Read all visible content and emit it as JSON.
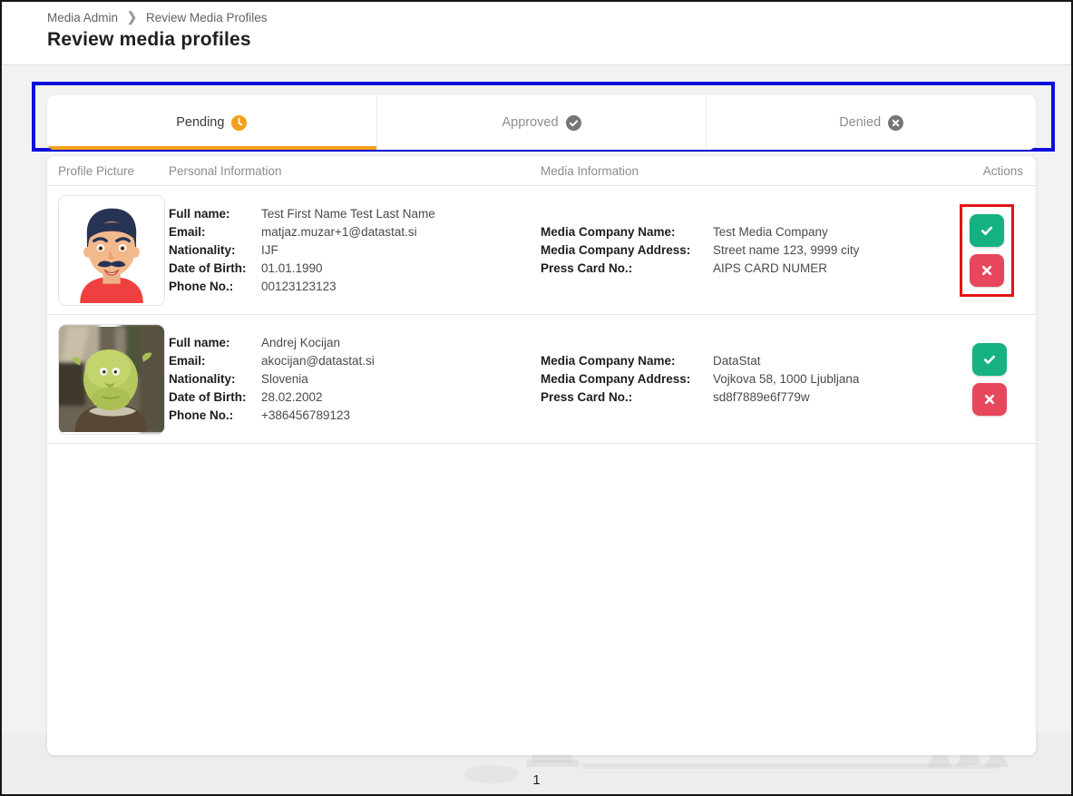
{
  "header": {
    "breadcrumb": [
      "Media Admin",
      "Review Media Profiles"
    ],
    "breadcrumb_separator": "❯",
    "title": "Review media profiles"
  },
  "tabs": [
    {
      "label": "Pending",
      "icon": "clock-icon",
      "active": true
    },
    {
      "label": "Approved",
      "icon": "check-circle-icon",
      "active": false
    },
    {
      "label": "Denied",
      "icon": "x-circle-icon",
      "active": false
    }
  ],
  "table": {
    "columns": [
      "Profile Picture",
      "Personal Information",
      "Media Information",
      "Actions"
    ],
    "personal_labels": [
      "Full name:",
      "Email:",
      "Nationality:",
      "Date of Birth:",
      "Phone No.:"
    ],
    "media_labels": [
      "Media Company Name:",
      "Media Company Address:",
      "Press Card No.:"
    ],
    "rows": [
      {
        "avatar": "cartoon-man-avatar",
        "personal": {
          "full_name": "Test First Name Test Last Name",
          "email": "matjaz.muzar+1@datastat.si",
          "nationality": "IJF",
          "date_of_birth": "01.01.1990",
          "phone": "00123123123"
        },
        "media": {
          "company_name": "Test Media Company",
          "company_address": "Street name 123, 9999 city",
          "press_card_no": "AIPS CARD NUMER"
        }
      },
      {
        "avatar": "shrek-avatar",
        "personal": {
          "full_name": "Andrej Kocijan",
          "email": "akocijan@datastat.si",
          "nationality": "Slovenia",
          "date_of_birth": "28.02.2002",
          "phone": "+386456789123"
        },
        "media": {
          "company_name": "DataStat",
          "company_address": "Vojkova 58, 1000 Ljubljana",
          "press_card_no": "sd8f7889e6f779w"
        }
      }
    ]
  },
  "pagination": {
    "current_page": "1"
  },
  "colors": {
    "approve_button": "#16b181",
    "deny_button": "#e8465c",
    "pending_accent": "#f2a019",
    "inactive_tab_icon": "#767676",
    "tabs_annotation": "#0d0ddb",
    "actions_annotation": "#e51313"
  }
}
